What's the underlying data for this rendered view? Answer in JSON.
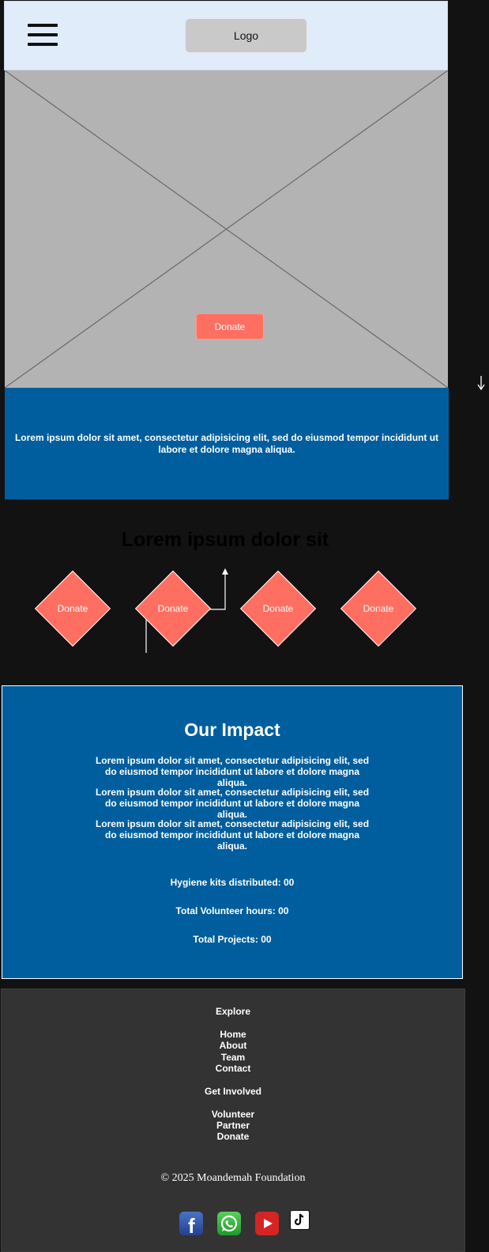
{
  "header": {
    "logo_text": "Logo"
  },
  "hero": {
    "donate_label": "Donate"
  },
  "intro": {
    "text": "Lorem ipsum dolor sit amet, consectetur adipisicing elit, sed do eiusmod tempor incididunt ut labore et dolore magna aliqua."
  },
  "donate_section": {
    "title": "Lorem ipsum dolor sit",
    "buttons": [
      "Donate",
      "Donate",
      "Donate",
      "Donate"
    ]
  },
  "impact": {
    "title": "Our Impact",
    "paragraphs": [
      "Lorem ipsum dolor sit amet, consectetur adipisicing elit, sed do eiusmod tempor incididunt ut labore et dolore magna aliqua.",
      "Lorem ipsum dolor sit amet, consectetur adipisicing elit, sed do eiusmod tempor incididunt ut labore et dolore magna aliqua.",
      "Lorem ipsum dolor sit amet, consectetur adipisicing elit, sed do eiusmod tempor incididunt ut labore et dolore magna aliqua."
    ],
    "stats": [
      "Hygiene kits distributed: 00",
      "Total Volunteer hours: 00",
      "Total Projects: 00"
    ]
  },
  "footer": {
    "explore_heading": "Explore",
    "explore_links": [
      "Home",
      "About",
      "Team",
      "Contact"
    ],
    "involved_heading": "Get Involved",
    "involved_links": [
      "Volunteer",
      "Partner",
      "Donate"
    ],
    "copyright": "© 2025 Moandemah Foundation",
    "social_icons": [
      "facebook-icon",
      "whatsapp-icon",
      "youtube-icon",
      "tiktok-icon"
    ]
  },
  "colors": {
    "header_bg": "#e0ecfa",
    "accent_blue": "#005e9e",
    "donate_coral": "#ff6f61",
    "page_bg": "#121212",
    "footer_bg": "#333333"
  }
}
